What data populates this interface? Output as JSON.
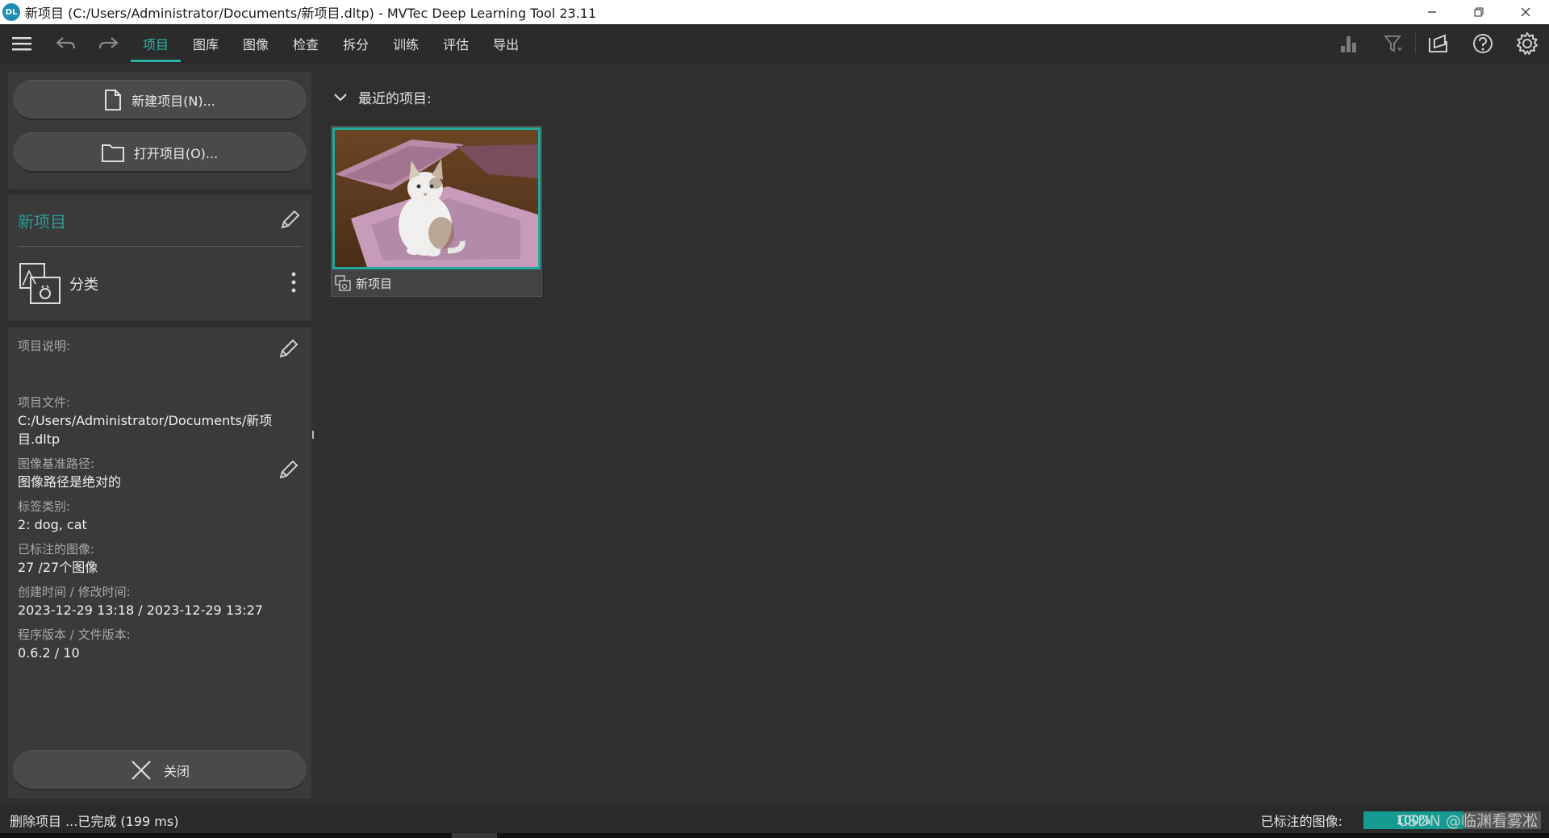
{
  "window": {
    "title": "新项目 (C:/Users/Administrator/Documents/新项目.dltp) - MVTec Deep Learning Tool 23.11",
    "logo_text": "DL",
    "controls": [
      "minimize",
      "restore",
      "close"
    ]
  },
  "toolbar": {
    "tabs": [
      {
        "label": "项目",
        "active": true
      },
      {
        "label": "图库",
        "active": false
      },
      {
        "label": "图像",
        "active": false
      },
      {
        "label": "检查",
        "active": false
      },
      {
        "label": "拆分",
        "active": false
      },
      {
        "label": "训练",
        "active": false
      },
      {
        "label": "评估",
        "active": false
      },
      {
        "label": "导出",
        "active": false
      }
    ],
    "left_icons": [
      "menu-icon",
      "undo-icon",
      "redo-icon"
    ],
    "right_icons": [
      "statistics-icon",
      "filter-icon",
      "feedback-icon",
      "help-icon",
      "settings-icon"
    ]
  },
  "sidebar": {
    "new_project_label": "新建项目(N)...",
    "open_project_label": "打开项目(O)...",
    "project_name": "新项目",
    "project_type": "分类",
    "info": {
      "description_label": "项目说明:",
      "file_label": "项目文件:",
      "file_value": "C:/Users/Administrator/Documents/新项目.dltp",
      "file_value_line1": "C:/Users/Administrator/Documents/新项",
      "file_value_line2": "目.dltp",
      "image_base_label": "图像基准路径:",
      "image_base_value": "图像路径是绝对的",
      "classes_label": "标签类别:",
      "classes_value": "2: dog, cat",
      "labeled_label": "已标注的图像:",
      "labeled_value": "27 /27个图像",
      "time_label": "创建时间 / 修改时间:",
      "time_value": "2023-12-29 13:18 / 2023-12-29 13:27",
      "version_label": "程序版本 / 文件版本:",
      "version_value": "0.6.2 / 10"
    },
    "close_label": "关闭"
  },
  "main": {
    "recent_header": "最近的项目:",
    "recent_projects": [
      {
        "name": "新项目"
      }
    ]
  },
  "statusbar": {
    "message": "删除项目 ...已完成 (199 ms)",
    "labeled_label": "已标注的图像:",
    "labeled_progress_text": "100%",
    "labeled_progress_value": 1.0,
    "watermark": "CSDN @临渊看雾凇"
  },
  "colors": {
    "accent": "#2fb3a6",
    "background": "#2f2f2f",
    "panel": "#3a3a3a",
    "progress": "#159b8f"
  }
}
